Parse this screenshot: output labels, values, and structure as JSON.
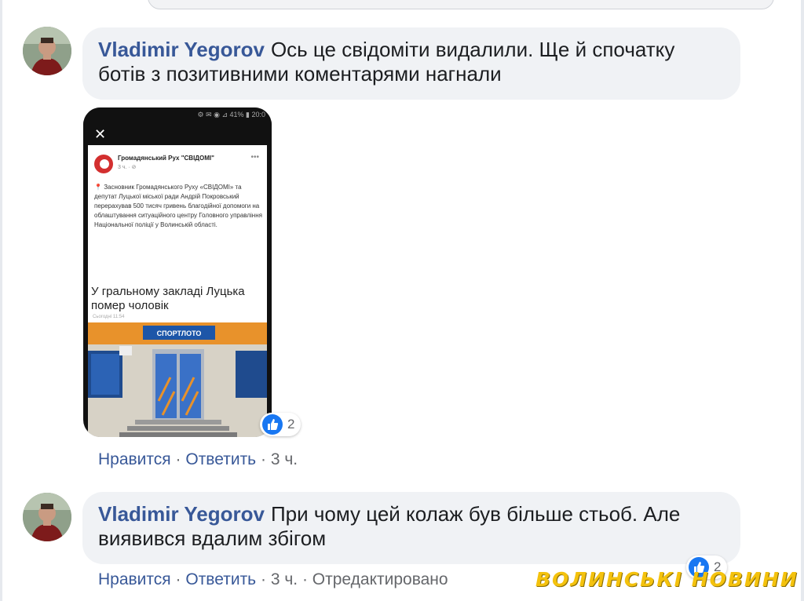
{
  "comments": [
    {
      "author": "Vladimir Yegorov",
      "text": "Ось це свідоміти видалили. Ще й спочатку ботів з позитивними коментарями нагнали",
      "reaction_count": "2",
      "actions": {
        "like": "Нравится",
        "reply": "Ответить",
        "time": "3 ч."
      }
    },
    {
      "author": "Vladimir Yegorov",
      "text": "При чому цей колаж був більше стьоб. Але виявився вдалим збігом",
      "reaction_count": "2",
      "actions": {
        "like": "Нравится",
        "reply": "Ответить",
        "time": "3 ч.",
        "edited": "Отредактировано"
      }
    }
  ],
  "attachment": {
    "status_bar": "⚙ ✉ ◉ ⊿ 41% ▮ 20:0",
    "post_author": "Громадянський Рух \"СВІДОМІ\"",
    "post_meta": "3 ч. · ⊘",
    "post_text": "Засновник Громадянського Руху «СВІДОМІ» та депутат Луцької міської ради Андрій Покровський перерахував 500 тисяч гривень благодійної допомоги на облаштування ситуаційного центру Головного управління Національної поліції у Волинській області.",
    "news_headline": "У гральному закладі Луцька помер чоловік",
    "news_date": "Сьогодні 11:54",
    "store_sign": "СПОРТЛОТО"
  },
  "separator": "·",
  "watermark": "ВОЛИНСЬКІ НОВИНИ",
  "colors": {
    "link": "#385898",
    "bubble": "#f0f2f5",
    "like": "#1877f2",
    "watermark": "#f4c20d"
  }
}
